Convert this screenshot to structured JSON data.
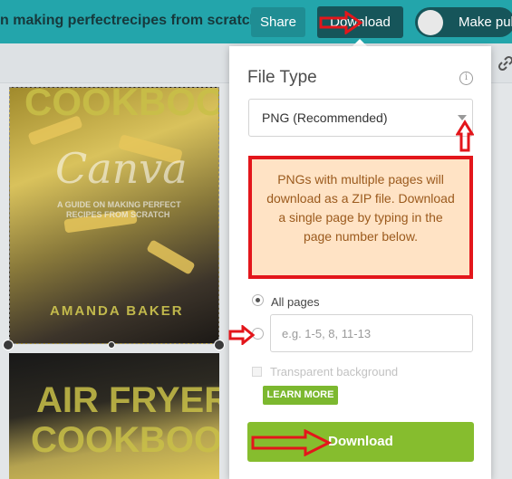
{
  "header": {
    "doc_title": "n making perfectrecipes from scratch",
    "share_label": "Share",
    "download_label": "Download",
    "publish_label": "Make public"
  },
  "pages": {
    "page1": {
      "title_word": "COOKBOOK",
      "brand_script": "Canva",
      "subtitle_line1": "A GUIDE ON MAKING PERFECT",
      "subtitle_line2": "RECIPES FROM SCRATCH",
      "author": "AMANDA BAKER"
    },
    "page2": {
      "title_line1": "AIR FRYER",
      "title_line2": "COOKBOOK"
    }
  },
  "download_panel": {
    "file_type_label": "File Type",
    "file_type_value": "PNG (Recommended)",
    "notice_text": "PNGs with multiple pages will download as a ZIP file. Download a single page by typing in the page number below.",
    "all_pages_label": "All pages",
    "pages_placeholder": "e.g. 1-5, 8, 11-13",
    "transparent_label": "Transparent background",
    "learn_more_label": "LEARN MORE",
    "download_button_label": "Download"
  },
  "colors": {
    "topbar": "#23a5ab",
    "download_accent": "#86bd2e",
    "notice_bg": "#ffe3c5",
    "annotation_red": "#e3161b"
  },
  "icons": {
    "info": "info-icon",
    "link": "link-icon",
    "select_caret": "chevron-down-icon"
  }
}
